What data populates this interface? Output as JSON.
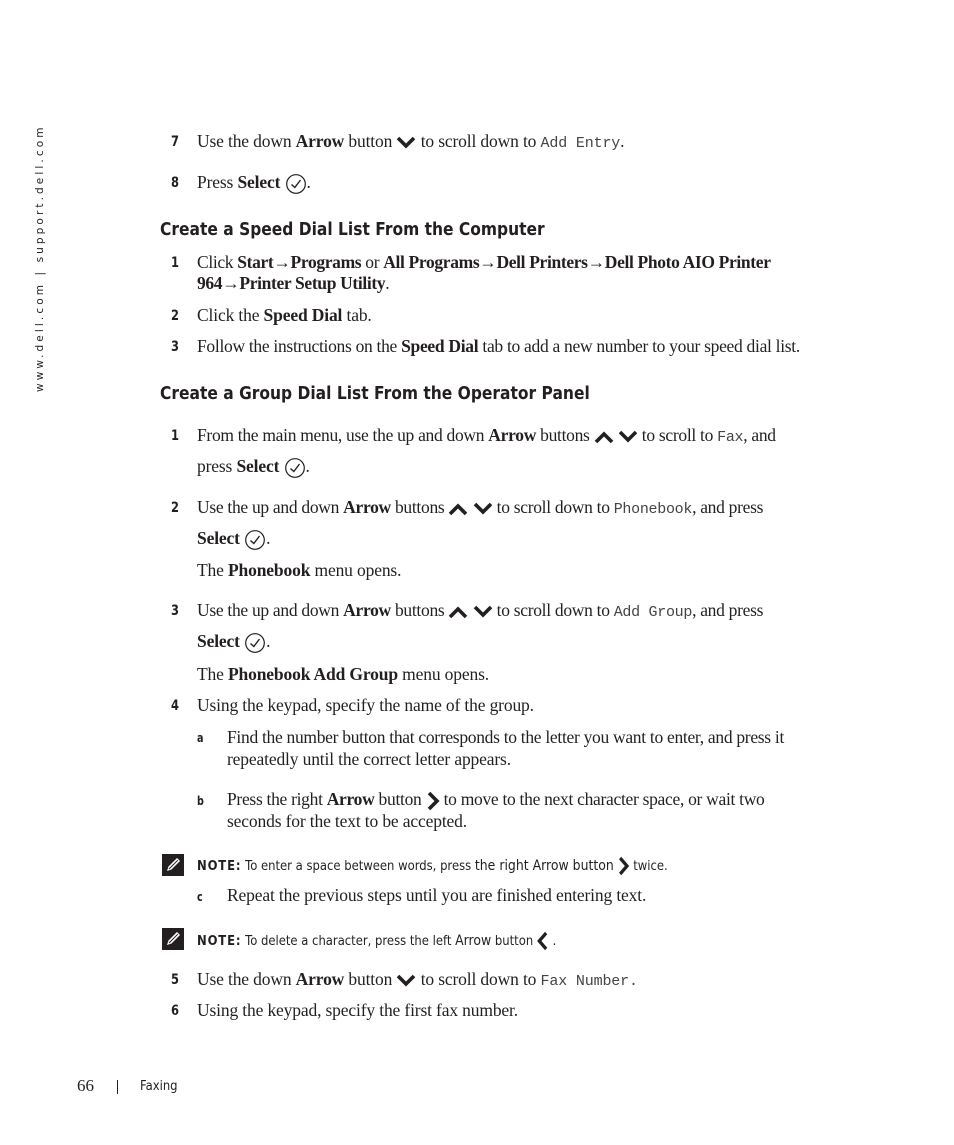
{
  "side_url": "www.dell.com | support.dell.com",
  "top_steps": [
    {
      "num": "7",
      "pre": "Use the down ",
      "bold": "Arrow",
      "mid": " button",
      "post": " to scroll down to ",
      "code": "Add Entry",
      "end": "."
    },
    {
      "num": "8",
      "pre": "Press ",
      "bold": "Select",
      "end": "."
    }
  ],
  "section1": {
    "title": "Create a Speed Dial List From the Computer",
    "steps": [
      {
        "num": "1",
        "line1_pre": "Click ",
        "s1": "Start",
        "a1": "→",
        "s2": "Programs",
        "or": " or ",
        "s3": "All Programs",
        "a2": "→",
        "s4": "Dell Printers",
        "a3": "→",
        "s5": "Dell Photo AIO Printer",
        "line2_s": "964",
        "a4": "→",
        "s6": "Printer Setup Utility",
        "end": "."
      },
      {
        "num": "2",
        "pre": "Click the ",
        "bold": "Speed Dial",
        "post": " tab."
      },
      {
        "num": "3",
        "pre": "Follow the instructions on the ",
        "bold": "Speed Dial",
        "post": " tab to add a new number to your speed dial list."
      }
    ]
  },
  "section2": {
    "title": "Create a Group Dial List From the Operator Panel",
    "step1": {
      "num": "1",
      "pre": "From the main menu, use the up and down ",
      "bold": "Arrow",
      "mid": " buttons",
      "post": " to scroll to ",
      "code": "Fax",
      "post2": ", and",
      "line2_pre": "press ",
      "line2_bold": "Select",
      "end": "."
    },
    "step2": {
      "num": "2",
      "pre": "Use the up and down ",
      "bold": "Arrow",
      "mid": " buttons",
      "post": " to scroll down to ",
      "code": "Phonebook",
      "post2": ", and press",
      "line2_bold": "Select",
      "end": ".",
      "result_pre": "The ",
      "result_bold": "Phonebook",
      "result_post": " menu opens."
    },
    "step3": {
      "num": "3",
      "pre": "Use the up and down ",
      "bold": "Arrow",
      "mid": " buttons",
      "post": " to scroll down to ",
      "code": "Add Group",
      "post2": ", and press",
      "line2_bold": "Select",
      "end": ".",
      "result_pre": "The ",
      "result_bold": "Phonebook Add Group",
      "result_post": " menu opens."
    },
    "step4": {
      "num": "4",
      "text": "Using the keypad, specify the name of the group.",
      "sub_a": {
        "letter": "a",
        "line1": "Find the number button that corresponds to the letter you want to enter, and press it",
        "line2": "repeatedly until the correct letter appears."
      },
      "sub_b": {
        "letter": "b",
        "pre": "Press the right ",
        "bold": "Arrow",
        "mid": " button",
        "post": " to move to the next character space, or wait two",
        "line2": "seconds for the text to be accepted."
      },
      "note1": {
        "label": "NOTE:",
        "pre": " To enter a space between words, press ",
        "bold": "the right Arrow button",
        "post": " twice."
      },
      "sub_c": {
        "letter": "c",
        "text": "Repeat the previous steps until you are finished entering text."
      },
      "note2": {
        "label": "NOTE:",
        "pre": " To delete a character, press the left ",
        "bold": "Arrow",
        "post": " button",
        "end": " ."
      }
    },
    "step5": {
      "num": "5",
      "pre": "Use the down ",
      "bold": "Arrow",
      "mid": " button",
      "post": " to scroll down to ",
      "code": "Fax Number."
    },
    "step6": {
      "num": "6",
      "text": "Using the keypad, specify the first fax number."
    }
  },
  "footer": {
    "page_number": "66",
    "section": "Faxing"
  }
}
